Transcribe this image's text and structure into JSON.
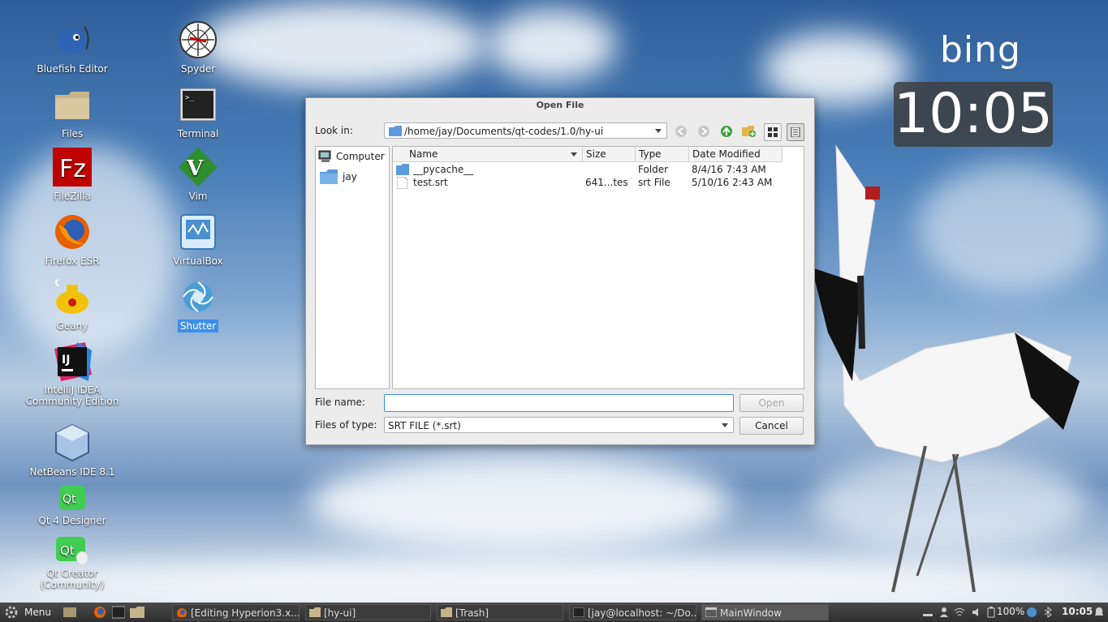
{
  "desktop": {
    "icons": [
      {
        "label": "Bluefish Editor",
        "icon": "bluefish-icon"
      },
      {
        "label": "Files",
        "icon": "folder-icon"
      },
      {
        "label": "FileZilla",
        "icon": "filezilla-icon"
      },
      {
        "label": "Firefox ESR",
        "icon": "firefox-icon"
      },
      {
        "label": "Geany",
        "icon": "geany-icon"
      },
      {
        "label": "IntelliJ IDEA Community Edition",
        "line1": "IntelliJ IDEA",
        "line2": "Community Edition",
        "icon": "intellij-icon"
      },
      {
        "label": "NetBeans IDE 8.1",
        "icon": "netbeans-icon"
      },
      {
        "label": "Qt 4 Designer",
        "icon": "qt-designer-icon"
      },
      {
        "label": "Qt Creator (Community)",
        "line1": "Qt Creator",
        "line2": "(Community)",
        "icon": "qt-creator-icon"
      },
      {
        "label": "Spyder",
        "icon": "spyder-icon"
      },
      {
        "label": "Terminal",
        "icon": "terminal-icon"
      },
      {
        "label": "Vim",
        "icon": "vim-icon"
      },
      {
        "label": "VirtualBox",
        "icon": "virtualbox-icon"
      },
      {
        "label": "Shutter",
        "icon": "shutter-icon",
        "selected": true
      }
    ]
  },
  "widget": {
    "bing": "bing",
    "clock": "10:05"
  },
  "dialog": {
    "title": "Open File",
    "look_in_label": "Look in:",
    "look_in_value": "/home/jay/Documents/qt-codes/1.0/hy-ui",
    "sidebar": [
      {
        "label": "Computer",
        "icon": "computer-icon"
      },
      {
        "label": "jay",
        "icon": "folder-icon"
      }
    ],
    "columns": {
      "name": "Name",
      "size": "Size",
      "type": "Type",
      "date": "Date Modified"
    },
    "files": [
      {
        "name": "__pycache__",
        "size": "",
        "type": "Folder",
        "date": "8/4/16 7:43 AM",
        "icon": "folder-icon"
      },
      {
        "name": "test.srt",
        "size": "641...tes",
        "type": "srt File",
        "date": "5/10/16 2:43 AM",
        "icon": "file-icon"
      }
    ],
    "file_name_label": "File name:",
    "file_name_value": "",
    "files_of_type_label": "Files of type:",
    "files_of_type_value": "SRT FILE (*.srt)",
    "open_label": "Open",
    "cancel_label": "Cancel"
  },
  "taskbar": {
    "menu_label": "Menu",
    "tasks": [
      {
        "label": "[Editing Hyperion3.x...",
        "icon": "firefox-icon"
      },
      {
        "label": "[hy-ui]",
        "icon": "folder-icon"
      },
      {
        "label": "[Trash]",
        "icon": "folder-icon"
      },
      {
        "label": "[jay@localhost: ~/Do...",
        "icon": "terminal-icon"
      },
      {
        "label": "MainWindow",
        "icon": "window-icon",
        "active": true
      }
    ],
    "battery": "100%",
    "time": "10:05"
  }
}
